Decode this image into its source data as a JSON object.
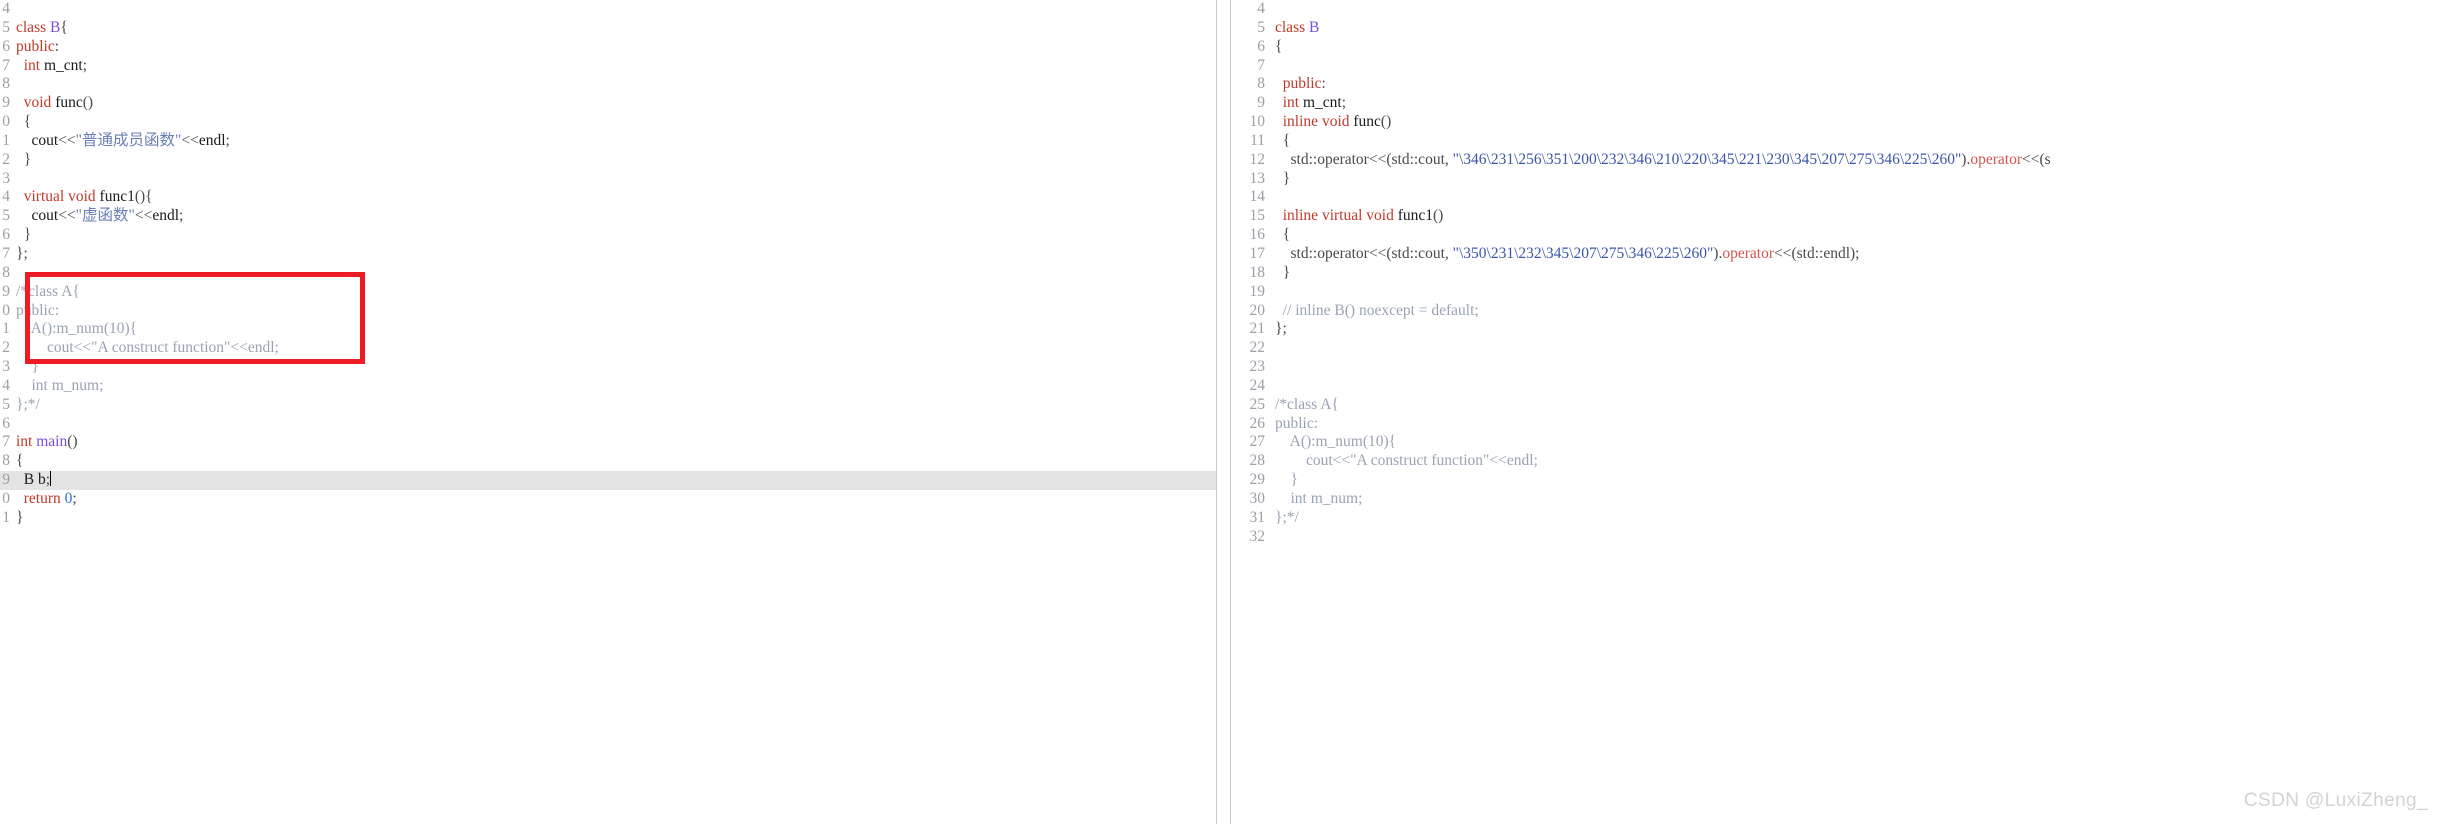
{
  "editor": {
    "panes": [
      {
        "id": "left",
        "name": "source-pane",
        "gutter_clipped": true,
        "first_line": 4,
        "highlight_line": 19,
        "caret_line": 19,
        "lines": [
          {
            "num": "4",
            "tokens": []
          },
          {
            "num": "5",
            "tokens": [
              {
                "t": "class",
                "c": "kw"
              },
              {
                "t": " ",
                "c": "pln"
              },
              {
                "t": "B",
                "c": "typ"
              },
              {
                "t": "{",
                "c": "op"
              }
            ]
          },
          {
            "num": "6",
            "tokens": [
              {
                "t": "public",
                "c": "kw"
              },
              {
                "t": ":",
                "c": "op"
              }
            ]
          },
          {
            "num": "7",
            "tokens": [
              {
                "t": "  ",
                "c": "pln"
              },
              {
                "t": "int",
                "c": "kw"
              },
              {
                "t": " ",
                "c": "pln"
              },
              {
                "t": "m_cnt",
                "c": "pln"
              },
              {
                "t": ";",
                "c": "op"
              }
            ]
          },
          {
            "num": "8",
            "tokens": []
          },
          {
            "num": "9",
            "tokens": [
              {
                "t": "  ",
                "c": "pln"
              },
              {
                "t": "void",
                "c": "kw"
              },
              {
                "t": " ",
                "c": "pln"
              },
              {
                "t": "func",
                "c": "pln"
              },
              {
                "t": "()",
                "c": "op"
              }
            ]
          },
          {
            "num": "0",
            "tokens": [
              {
                "t": "  {",
                "c": "op"
              }
            ]
          },
          {
            "num": "1",
            "tokens": [
              {
                "t": "    ",
                "c": "pln"
              },
              {
                "t": "cout",
                "c": "pln"
              },
              {
                "t": "<<",
                "c": "op"
              },
              {
                "t": "\"普通成员函数\"",
                "c": "str"
              },
              {
                "t": "<<",
                "c": "op"
              },
              {
                "t": "endl",
                "c": "pln"
              },
              {
                "t": ";",
                "c": "op"
              }
            ]
          },
          {
            "num": "2",
            "tokens": [
              {
                "t": "  }",
                "c": "op"
              }
            ]
          },
          {
            "num": "3",
            "tokens": []
          },
          {
            "num": "4",
            "tokens": [
              {
                "t": "  ",
                "c": "pln"
              },
              {
                "t": "virtual",
                "c": "kw"
              },
              {
                "t": " ",
                "c": "pln"
              },
              {
                "t": "void",
                "c": "kw"
              },
              {
                "t": " ",
                "c": "pln"
              },
              {
                "t": "func1",
                "c": "pln"
              },
              {
                "t": "(){",
                "c": "op"
              }
            ]
          },
          {
            "num": "5",
            "tokens": [
              {
                "t": "    ",
                "c": "pln"
              },
              {
                "t": "cout",
                "c": "pln"
              },
              {
                "t": "<<",
                "c": "op"
              },
              {
                "t": "\"虚函数\"",
                "c": "str"
              },
              {
                "t": "<<",
                "c": "op"
              },
              {
                "t": "endl",
                "c": "pln"
              },
              {
                "t": ";",
                "c": "op"
              }
            ]
          },
          {
            "num": "6",
            "tokens": [
              {
                "t": "  }",
                "c": "op"
              }
            ]
          },
          {
            "num": "7",
            "tokens": [
              {
                "t": "};",
                "c": "op"
              }
            ]
          },
          {
            "num": "8",
            "tokens": []
          },
          {
            "num": "9",
            "tokens": [
              {
                "t": "/*class A{",
                "c": "cmt"
              }
            ]
          },
          {
            "num": "0",
            "tokens": [
              {
                "t": "public:",
                "c": "cmt"
              }
            ]
          },
          {
            "num": "1",
            "tokens": [
              {
                "t": "    A():m_num(10){",
                "c": "cmt"
              }
            ]
          },
          {
            "num": "2",
            "tokens": [
              {
                "t": "        cout<<\"A construct function\"<<endl;",
                "c": "cmt"
              }
            ]
          },
          {
            "num": "3",
            "tokens": [
              {
                "t": "    }",
                "c": "cmt"
              }
            ]
          },
          {
            "num": "4",
            "tokens": [
              {
                "t": "    int m_num;",
                "c": "cmt"
              }
            ]
          },
          {
            "num": "5",
            "tokens": [
              {
                "t": "};*/",
                "c": "cmt"
              }
            ]
          },
          {
            "num": "6",
            "tokens": []
          },
          {
            "num": "7",
            "tokens": [
              {
                "t": "int",
                "c": "kw"
              },
              {
                "t": " ",
                "c": "pln"
              },
              {
                "t": "main",
                "c": "typ"
              },
              {
                "t": "()",
                "c": "op"
              }
            ]
          },
          {
            "num": "8",
            "tokens": [
              {
                "t": "{",
                "c": "op"
              }
            ]
          },
          {
            "num": "9",
            "tokens": [
              {
                "t": "  ",
                "c": "pln"
              },
              {
                "t": "B",
                "c": "pln"
              },
              {
                "t": " ",
                "c": "pln"
              },
              {
                "t": "b",
                "c": "pln"
              },
              {
                "t": ";",
                "c": "op"
              }
            ],
            "caret": true,
            "highlight": true
          },
          {
            "num": "0",
            "tokens": [
              {
                "t": "  ",
                "c": "pln"
              },
              {
                "t": "return",
                "c": "kw"
              },
              {
                "t": " ",
                "c": "pln"
              },
              {
                "t": "0",
                "c": "num"
              },
              {
                "t": ";",
                "c": "op"
              }
            ]
          },
          {
            "num": "1",
            "tokens": [
              {
                "t": "}",
                "c": "op"
              }
            ]
          }
        ]
      },
      {
        "id": "right",
        "name": "expanded-pane",
        "gutter_clipped": false,
        "first_line": 4,
        "lines": [
          {
            "num": "4",
            "tokens": []
          },
          {
            "num": "5",
            "tokens": [
              {
                "t": "class",
                "c": "kw"
              },
              {
                "t": " ",
                "c": "pln"
              },
              {
                "t": "B",
                "c": "typ"
              }
            ]
          },
          {
            "num": "6",
            "tokens": [
              {
                "t": "{",
                "c": "op"
              }
            ]
          },
          {
            "num": "7",
            "tokens": []
          },
          {
            "num": "8",
            "tokens": [
              {
                "t": "  ",
                "c": "pln"
              },
              {
                "t": "public",
                "c": "kw"
              },
              {
                "t": ":",
                "c": "op"
              }
            ]
          },
          {
            "num": "9",
            "tokens": [
              {
                "t": "  ",
                "c": "pln"
              },
              {
                "t": "int",
                "c": "kw"
              },
              {
                "t": " ",
                "c": "pln"
              },
              {
                "t": "m_cnt",
                "c": "pln"
              },
              {
                "t": ";",
                "c": "op"
              }
            ]
          },
          {
            "num": "10",
            "tokens": [
              {
                "t": "  ",
                "c": "pln"
              },
              {
                "t": "inline",
                "c": "kw"
              },
              {
                "t": " ",
                "c": "pln"
              },
              {
                "t": "void",
                "c": "kw"
              },
              {
                "t": " ",
                "c": "pln"
              },
              {
                "t": "func",
                "c": "pln"
              },
              {
                "t": "()",
                "c": "op"
              }
            ]
          },
          {
            "num": "11",
            "tokens": [
              {
                "t": "  {",
                "c": "op"
              }
            ]
          },
          {
            "num": "12",
            "tokens": [
              {
                "t": "    std::operator<<(std::cout, ",
                "c": "op"
              },
              {
                "t": "\"\\346\\231\\256\\351\\200\\232\\346\\210\\220\\345\\221\\230\\345\\207\\275\\346\\225\\260\"",
                "c": "oct"
              },
              {
                "t": ").",
                "c": "op"
              },
              {
                "t": "operator",
                "c": "fnred"
              },
              {
                "t": "<<(s",
                "c": "op"
              }
            ]
          },
          {
            "num": "13",
            "tokens": [
              {
                "t": "  }",
                "c": "op"
              }
            ]
          },
          {
            "num": "14",
            "tokens": []
          },
          {
            "num": "15",
            "tokens": [
              {
                "t": "  ",
                "c": "pln"
              },
              {
                "t": "inline",
                "c": "kw"
              },
              {
                "t": " ",
                "c": "pln"
              },
              {
                "t": "virtual",
                "c": "kw"
              },
              {
                "t": " ",
                "c": "pln"
              },
              {
                "t": "void",
                "c": "kw"
              },
              {
                "t": " ",
                "c": "pln"
              },
              {
                "t": "func1",
                "c": "pln"
              },
              {
                "t": "()",
                "c": "op"
              }
            ]
          },
          {
            "num": "16",
            "tokens": [
              {
                "t": "  {",
                "c": "op"
              }
            ]
          },
          {
            "num": "17",
            "tokens": [
              {
                "t": "    std::operator<<(std::cout, ",
                "c": "op"
              },
              {
                "t": "\"\\350\\231\\232\\345\\207\\275\\346\\225\\260\"",
                "c": "oct"
              },
              {
                "t": ").",
                "c": "op"
              },
              {
                "t": "operator",
                "c": "fnred"
              },
              {
                "t": "<<(std::endl);",
                "c": "op"
              }
            ]
          },
          {
            "num": "18",
            "tokens": [
              {
                "t": "  }",
                "c": "op"
              }
            ]
          },
          {
            "num": "19",
            "tokens": []
          },
          {
            "num": "20",
            "tokens": [
              {
                "t": "  // inline B() noexcept = default;",
                "c": "cmt"
              }
            ]
          },
          {
            "num": "21",
            "tokens": [
              {
                "t": "};",
                "c": "op"
              }
            ]
          },
          {
            "num": "22",
            "tokens": []
          },
          {
            "num": "23",
            "tokens": []
          },
          {
            "num": "24",
            "tokens": []
          },
          {
            "num": "25",
            "tokens": [
              {
                "t": "/*class A{",
                "c": "cmt"
              }
            ]
          },
          {
            "num": "26",
            "tokens": [
              {
                "t": "public:",
                "c": "cmt"
              }
            ]
          },
          {
            "num": "27",
            "tokens": [
              {
                "t": "    A():m_num(10){",
                "c": "cmt"
              }
            ]
          },
          {
            "num": "28",
            "tokens": [
              {
                "t": "        cout<<\"A construct function\"<<endl;",
                "c": "cmt"
              }
            ]
          },
          {
            "num": "29",
            "tokens": [
              {
                "t": "    }",
                "c": "cmt"
              }
            ]
          },
          {
            "num": "30",
            "tokens": [
              {
                "t": "    int m_num;",
                "c": "cmt"
              }
            ]
          },
          {
            "num": "31",
            "tokens": [
              {
                "t": "};*/",
                "c": "cmt"
              }
            ]
          },
          {
            "num": "32",
            "tokens": []
          }
        ]
      }
    ]
  },
  "annotation": {
    "redbox": {
      "color": "#ee1c25",
      "covers_lines": [
        "14",
        "15",
        "16"
      ],
      "covers_text": "virtual void func1(){ cout<<\"虚函数\"<<endl; }"
    }
  },
  "watermark": {
    "text": "CSDN @LuxiZheng_",
    "color": "#d3d3d3"
  },
  "colors": {
    "keyword": "#c0392b",
    "type": "#7b4ddb",
    "string": "#6b7fb5",
    "comment": "#9aa3b5",
    "number": "#2f6fd0",
    "octal_string": "#3a56a8",
    "operator_fn": "#d5544f",
    "gutter": "#9aa0a6",
    "highlight_row": "#e4e4e4",
    "divider": "#c9c9c9",
    "background": "#ffffff"
  }
}
